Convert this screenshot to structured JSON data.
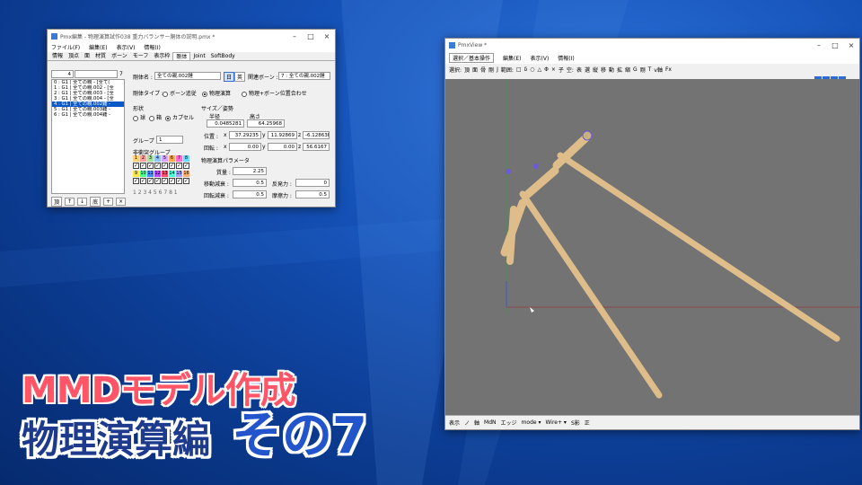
{
  "editor": {
    "title": "Pmx編集 - 物理演算試作038 重力バランサー胴体の説明.pmx *",
    "menu": [
      "ファイル(F)",
      "編集(E)",
      "表示(V)",
      "情報(I)"
    ],
    "tabs": [
      "情報",
      "頂点",
      "面",
      "材質",
      "ボーン",
      "モーフ",
      "表示枠",
      "剛体",
      "Joint",
      "SoftBody"
    ],
    "active_tab": "剛体",
    "list_count": "4",
    "list_total": "7",
    "list_items": [
      "0 : G1 | 全ての親 - [全て(",
      "1 : G1 | 全ての親.002 - [全",
      "2 : G1 | 全ての親.003 - [全",
      "3 : G1 | 全ての親.004 - [全",
      "4 : G1 | 全ての親.002錘 - ",
      "5 : G1 | 全ての親.003錘 - ",
      "6 : G1 | 全ての親.004錘 - "
    ],
    "selected_index": 4,
    "list_buttons": [
      "頂",
      "↑",
      "↓",
      "底",
      "+",
      "×"
    ],
    "body_name_label": "剛体名 :",
    "body_name": "全ての親.002錘",
    "jp_btn": "日",
    "en_btn": "英",
    "related_bone_label": "関連ボーン :",
    "related_bone": "7 : 全ての親.002錘",
    "type_label": "剛体タイプ :",
    "type_options": [
      "ボーン追従",
      "物理演算",
      "物理+ボーン位置合わせ"
    ],
    "type_selected": 1,
    "shape_label": "形状",
    "shape_options": [
      "球",
      "箱",
      "カプセル"
    ],
    "shape_selected": 2,
    "size_label": "サイズ／姿勢",
    "radius_label": "半径",
    "height_label": "高さ",
    "radius": "0.0485281",
    "height": "64.25968",
    "pos_label": "位置 :",
    "pos_x": "37.29235",
    "pos_y": "11.92869",
    "pos_z": "-6.12863E",
    "rot_label": "回転 :",
    "rot_x": "0.00",
    "rot_y": "0.00",
    "rot_z": "56.6167",
    "group_label": "グループ :",
    "group_value": "1",
    "noncollide_label": "非衝突グループ",
    "groups_row1": [
      "1",
      "2",
      "3",
      "4",
      "5",
      "6",
      "7",
      "8"
    ],
    "groups_row2": [
      "9",
      "10",
      "11",
      "12",
      "13",
      "14",
      "15",
      "16"
    ],
    "group_colors": [
      "#ffd27a",
      "#ff9e9e",
      "#a6e09a",
      "#8ec3ff",
      "#d9a3ff",
      "#ffa84d",
      "#ff6bd0",
      "#6bdcff",
      "#ffe64d",
      "#4dff8a",
      "#4d8aff",
      "#b84dff",
      "#ff4d6b",
      "#4dffd9",
      "#a3a3ff",
      "#ffae6b"
    ],
    "group_numbers": "1 2 3 4 5 6 7 8 1",
    "phys_label": "物理演算パラメータ",
    "mass_label": "質量 :",
    "mass": "2.25",
    "move_label": "移動減衰 :",
    "move": "0.5",
    "rotd_label": "回転減衰 :",
    "rotd": "0.5",
    "rep_label": "反発力 :",
    "rep": "0",
    "fric_label": "摩擦力 :",
    "fric": "0.5"
  },
  "viewer": {
    "title": "PmxView *",
    "mode_select": "選択／基本操作",
    "menu": [
      "編集(E)",
      "表示(V)",
      "情報(I)"
    ],
    "toolbar2": [
      "選択:",
      "頂",
      "面",
      "骨",
      "剛",
      "J",
      "範囲:",
      "□",
      "δ",
      "○",
      "△",
      "Φ",
      "×",
      "子",
      "空:",
      "表",
      "選",
      "縦",
      "移",
      "動",
      "拡",
      "縮",
      "G",
      "剛",
      "T",
      "v軸",
      "Fx"
    ],
    "bottom": [
      "表示",
      "ノ",
      "軸",
      "MdN",
      "エッジ",
      "mode ▾",
      "Wire+ ▾",
      "S影",
      "正"
    ]
  },
  "overlay": {
    "line1": "MMDモデル作成",
    "line2": "物理演算編",
    "line3": "その7"
  }
}
